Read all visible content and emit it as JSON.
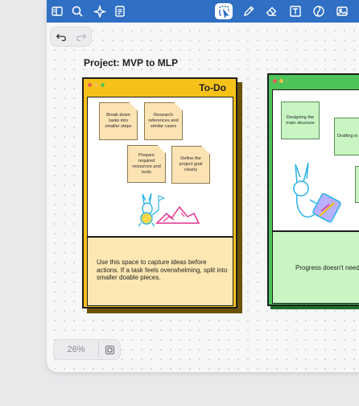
{
  "toolbar": {
    "icons": [
      "sidebar-icon",
      "search-icon",
      "sparkle-icon",
      "document-icon",
      "lasso-select-icon",
      "pen-icon",
      "eraser-icon",
      "text-box-icon",
      "shape-icon",
      "image-icon"
    ],
    "active": "lasso-select-icon",
    "colors": {
      "bar": "#2f6fc4",
      "icon": "#ffffff"
    }
  },
  "history": {
    "undo": "undo-icon",
    "redo": "redo-icon"
  },
  "canvas": {
    "title": "Project: MVP to MLP",
    "boards": [
      {
        "name": "To-Do",
        "color": "#f6c21a",
        "notes": [
          "Break down tasks into smaller steps",
          "Research references and similar cases",
          "Prepare required resources and tools",
          "Define the project goal clearly"
        ],
        "caption": "Use this space to capture ideas before actions. If a task feels overwhelming, split into smaller doable pieces."
      },
      {
        "name": "",
        "color": "#4cc458",
        "notes": [
          "Designing the main structure",
          "Drafting in concepts"
        ],
        "caption": "Progress doesn't need t"
      }
    ]
  },
  "zoom": {
    "value": "26%",
    "minimap": "minimap-icon"
  }
}
